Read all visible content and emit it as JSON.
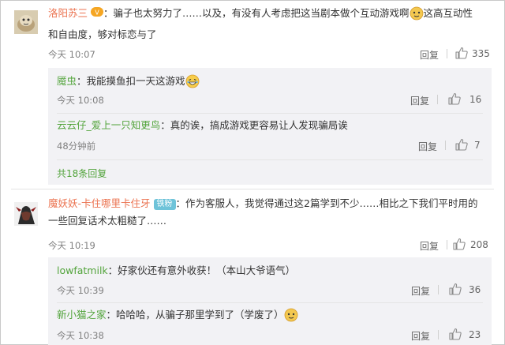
{
  "reply_label": "回复",
  "comments": [
    {
      "username": "洛阳苏三",
      "text_line1": "：骗子也太努力了……以及，有没有人考虑把这当剧本做个互动游戏啊",
      "text_line1b": "这高互动性",
      "text_line2": "和自由度，够对标恋与了",
      "time": "今天 10:07",
      "likes": "335",
      "replies": [
        {
          "username": "魇虫",
          "text": "：我能摸鱼扣一天这游戏",
          "time": "今天 10:08",
          "likes": "16"
        },
        {
          "username": "云云仔_爱上一只知更鸟",
          "text": "：真的诶，搞成游戏更容易让人发现骗局诶",
          "time": "48分钟前",
          "likes": "7"
        }
      ],
      "more_replies": "共18条回复"
    },
    {
      "username": "魔妖妖-卡住哪里卡住牙",
      "badge": "铁粉",
      "text_line1": "：作为客服人，我觉得通过这2篇学到不少……相比之下我们平时用的",
      "text_line2": "一些回复话术太粗糙了……",
      "time": "今天 10:19",
      "likes": "208",
      "replies": [
        {
          "username": "lowfatmilk",
          "text": "：好家伙还有意外收获！（本山大爷语气）",
          "time": "今天 10:39",
          "likes": "36"
        },
        {
          "username": "新小猫之家",
          "text": "：哈哈哈，从骗子那里学到了（学废了）",
          "time": "今天 10:38",
          "likes": "23"
        }
      ]
    }
  ]
}
